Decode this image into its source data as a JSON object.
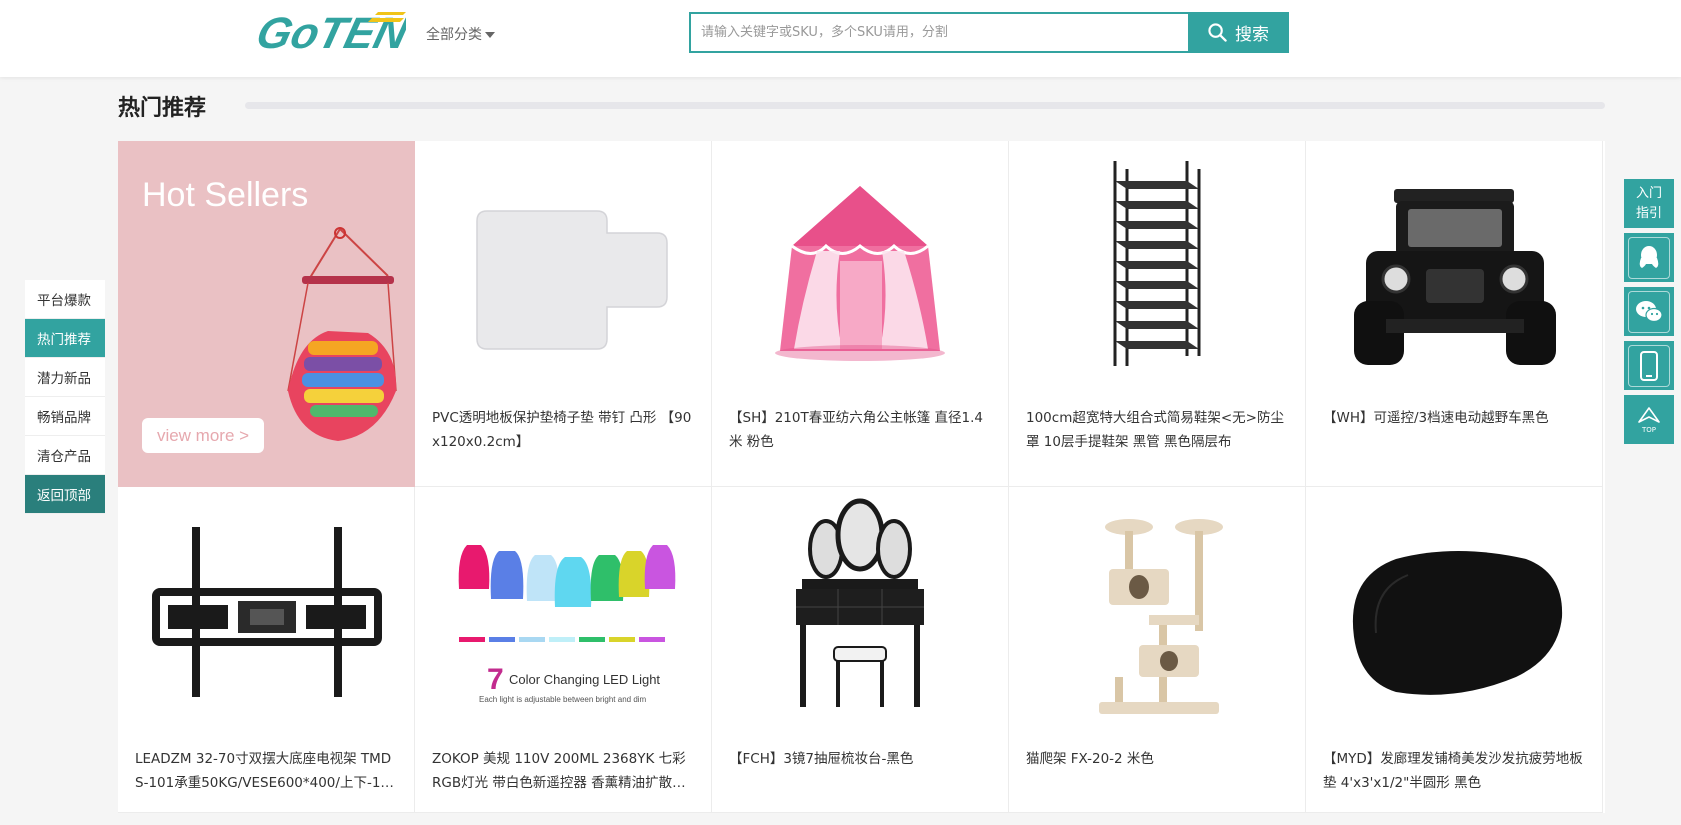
{
  "header": {
    "logo_text": "GoTEN",
    "category_menu": "全部分类",
    "search_placeholder": "请输入关键字或SKU，多个SKU请用，分割",
    "search_button": "搜索"
  },
  "section": {
    "title": "热门推荐"
  },
  "banner": {
    "title": "Hot Sellers",
    "button": "view more >"
  },
  "products": [
    {
      "name": "PVC透明地板保护垫椅子垫 带钉 凸形 【90x120x0.2cm】",
      "icon": "chair-mat-image"
    },
    {
      "name": "【SH】210T春亚纺六角公主帐篷 直径1.4米 粉色",
      "icon": "pink-tent-image"
    },
    {
      "name": "100cm超宽特大组合式简易鞋架<无>防尘罩 10层手提鞋架 黑管 黑色隔层布",
      "icon": "shoe-rack-image"
    },
    {
      "name": "【WH】可遥控/3档速电动越野车黑色",
      "icon": "toy-jeep-image"
    },
    {
      "name": "LEADZM 32-70寸双摆大底座电视架 TMDS-101承重50KG/VESE600*400/上下-10…",
      "icon": "tv-mount-image"
    },
    {
      "name": "ZOKOP 美规 110V 200ML 2368YK 七彩RGB灯光 带白色新遥控器 香薰精油扩散…",
      "icon": "diffuser-image"
    },
    {
      "name": "【FCH】3镜7抽屉梳妆台-黑色",
      "icon": "vanity-table-image"
    },
    {
      "name": "猫爬架 FX-20-2 米色",
      "icon": "cat-tree-image"
    },
    {
      "name": "【MYD】发廊理发铺椅美发沙发抗疲劳地板垫 4'x3'x1/2\"半圆形 黑色",
      "icon": "floor-mat-image"
    }
  ],
  "diffuser_caption": {
    "big": "7",
    "line1": "Color Changing LED Light",
    "line2": "Each light is adjustable between bright and dim"
  },
  "left_nav": [
    {
      "label": "平台爆款"
    },
    {
      "label": "热门推荐"
    },
    {
      "label": "潜力新品"
    },
    {
      "label": "畅销品牌"
    },
    {
      "label": "清仓产品"
    },
    {
      "label": "返回顶部"
    }
  ],
  "right_bar": {
    "guide_line1": "入门",
    "guide_line2": "指引",
    "top_label": "TOP",
    "icons": [
      "qq-icon",
      "wechat-icon",
      "mobile-icon",
      "back-to-top-icon"
    ]
  },
  "colors": {
    "accent": "#32a3a0",
    "accent_dark": "#2a7f7c",
    "banner_bg": "#eac1c4"
  }
}
